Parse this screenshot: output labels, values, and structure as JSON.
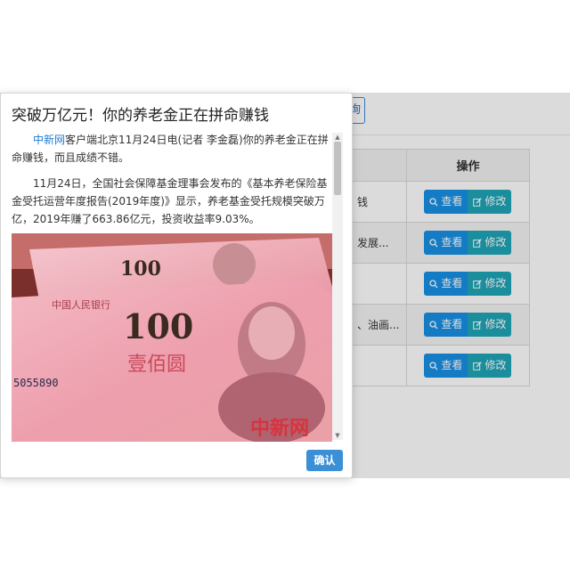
{
  "background": {
    "query_button_label": "询",
    "table": {
      "header_ops": "操作",
      "rows": [
        {
          "title": "钱"
        },
        {
          "title": "发展..."
        },
        {
          "title": ""
        },
        {
          "title": "、油画..."
        },
        {
          "title": ""
        }
      ],
      "view_label": "查看",
      "edit_label": "修改"
    }
  },
  "modal": {
    "title": "突破万亿元！你的养老金正在拼命赚钱",
    "para1_link": "中新网",
    "para1_text": "客户端北京11月24日电(记者 李金磊)你的养老金正在拼命赚钱，而且成绩不错。",
    "para2_text": "11月24日，全国社会保障基金理事会发布的《基本养老保险基金受托运营年度报告(2019年度)》显示，养老基金受托规模突破万亿，2019年赚了663.86亿元，投资收益率9.03%。",
    "image": {
      "note_100": "100",
      "note_label": "壹佰圆",
      "bank_label": "中国人民银行",
      "serial": "5055890",
      "watermark": "中新网"
    },
    "confirm_label": "确认"
  },
  "colors": {
    "primary": "#1890e6",
    "info": "#20a6b8",
    "link": "#1e7bd3",
    "confirm": "#3a8fd6"
  }
}
